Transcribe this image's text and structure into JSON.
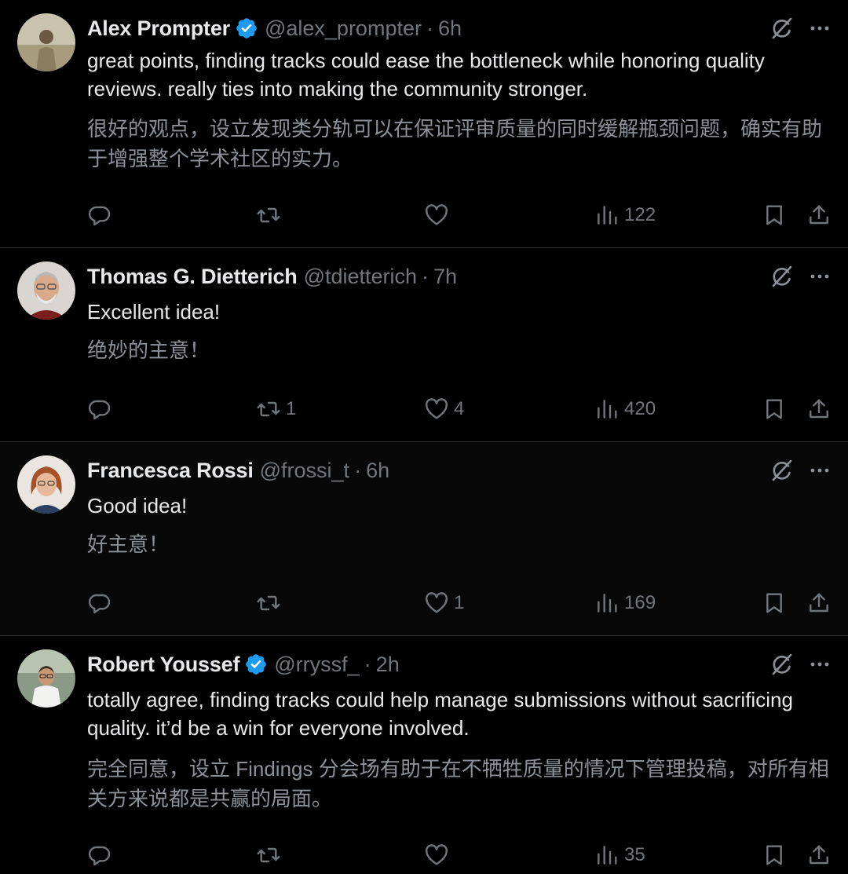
{
  "tweets": [
    {
      "name": "Alex Prompter",
      "verified": true,
      "handle": "@alex_prompter",
      "separator": "·",
      "time": "6h",
      "text": "great points, finding tracks could ease the bottleneck while honoring quality reviews. really ties into making the community stronger.",
      "translation": "很好的观点，设立发现类分轨可以在保证评审质量的同时缓解瓶颈问题，确实有助于增强整个学术社区的实力。",
      "replies": "",
      "retweets": "",
      "likes": "",
      "views": "122"
    },
    {
      "name": "Thomas G. Dietterich",
      "verified": false,
      "handle": "@tdietterich",
      "separator": "·",
      "time": "7h",
      "text": "Excellent idea!",
      "translation": "绝妙的主意！",
      "replies": "",
      "retweets": "1",
      "likes": "4",
      "views": "420"
    },
    {
      "name": "Francesca Rossi",
      "verified": false,
      "handle": "@frossi_t",
      "separator": "·",
      "time": "6h",
      "text": "Good idea!",
      "translation": "好主意！",
      "replies": "",
      "retweets": "",
      "likes": "1",
      "views": "169"
    },
    {
      "name": "Robert Youssef",
      "verified": true,
      "handle": "@rryssf_",
      "separator": "·",
      "time": "2h",
      "text": "totally agree, finding tracks could help manage submissions without sacrificing quality. it’d be a win for everyone involved.",
      "translation": "完全同意，设立 Findings 分会场有助于在不牺牲质量的情况下管理投稿，对所有相关方来说都是共赢的局面。",
      "replies": "",
      "retweets": "",
      "likes": "",
      "views": "35"
    }
  ],
  "icons": {
    "verified": "verified-badge-icon",
    "grok": "grok-icon",
    "more": "more-options-icon",
    "reply": "reply-icon",
    "retweet": "retweet-icon",
    "like": "heart-icon",
    "views": "views-icon",
    "bookmark": "bookmark-icon",
    "share": "share-icon"
  },
  "colors": {
    "background": "#000000",
    "text": "#e7e9ea",
    "secondary": "#71767b",
    "translation": "#8b9197",
    "verified": "#1d9bf0",
    "divider": "#2f3336"
  }
}
